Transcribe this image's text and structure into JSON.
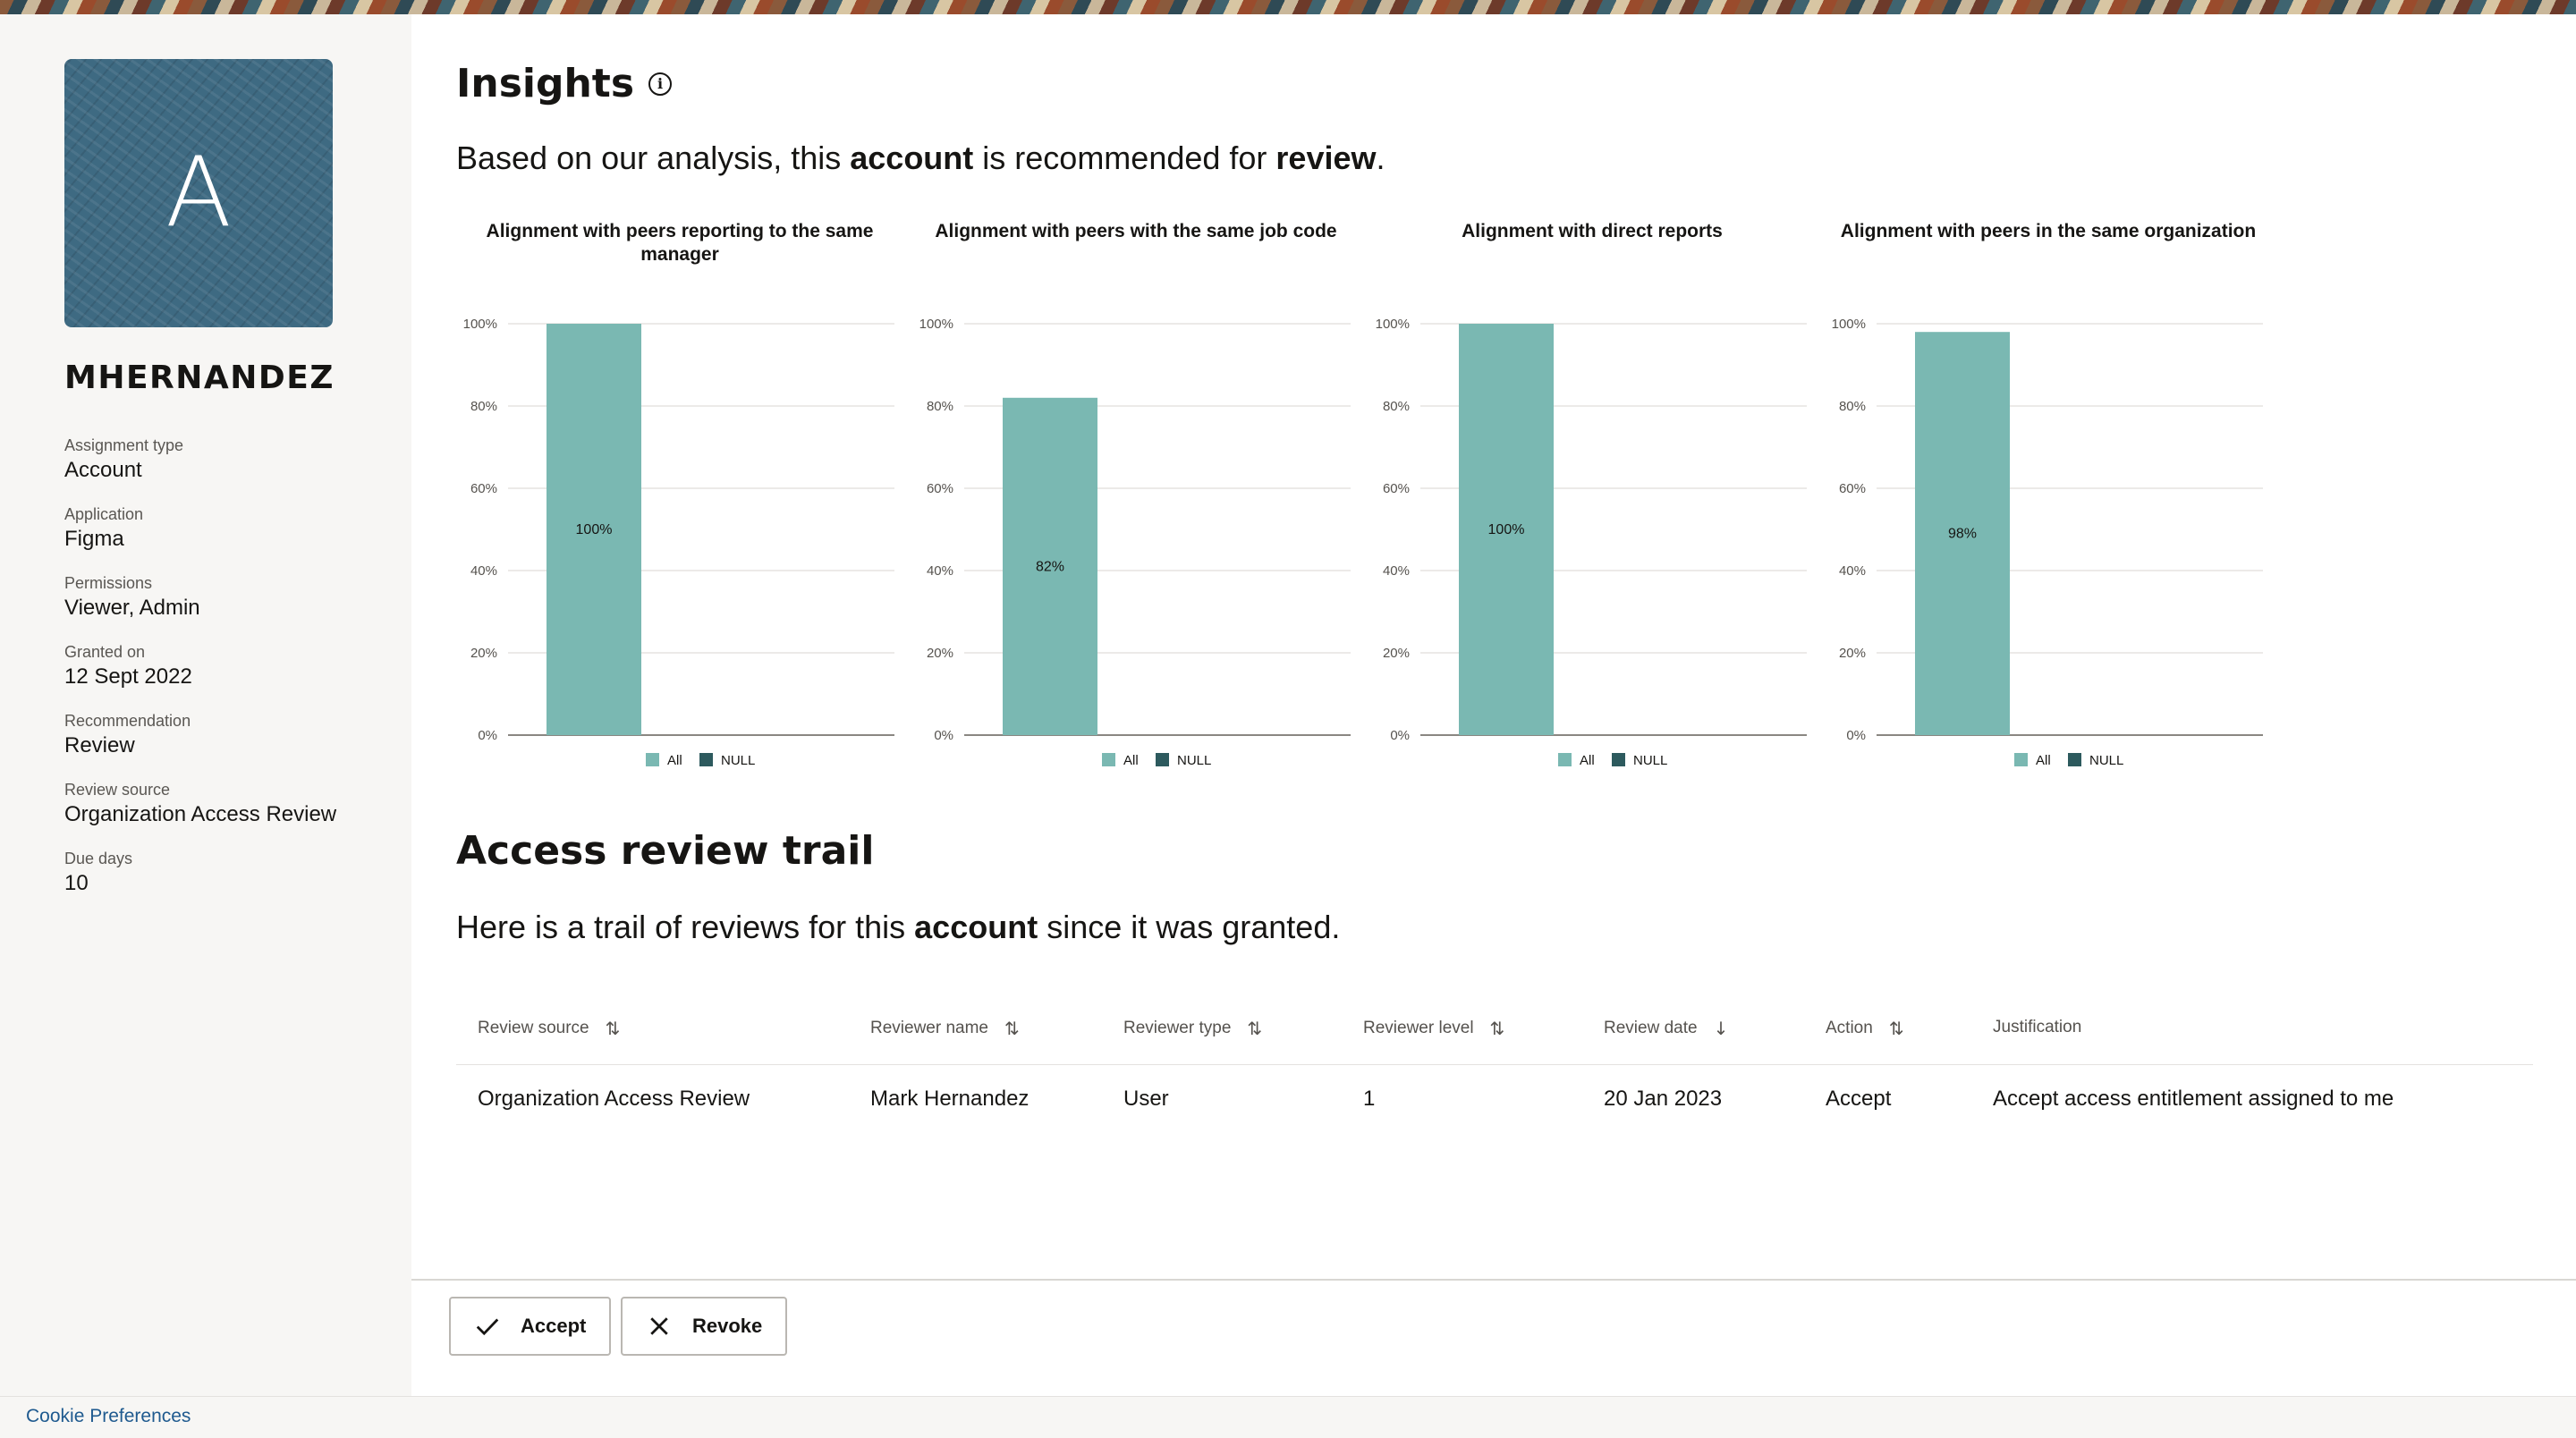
{
  "user": {
    "avatar_initial": "A",
    "username": "MHERNANDEZ",
    "fields": [
      {
        "label": "Assignment type",
        "value": "Account"
      },
      {
        "label": "Application",
        "value": "Figma"
      },
      {
        "label": "Permissions",
        "value": "Viewer, Admin"
      },
      {
        "label": "Granted on",
        "value": "12 Sept 2022"
      },
      {
        "label": "Recommendation",
        "value": "Review"
      },
      {
        "label": "Review source",
        "value": "Organization Access Review"
      },
      {
        "label": "Due days",
        "value": "10"
      }
    ]
  },
  "insights": {
    "title": "Insights",
    "lead_1": "Based on our analysis, this ",
    "lead_bold_1": "account",
    "lead_2": " is recommended for ",
    "lead_bold_2": "review",
    "lead_3": "."
  },
  "chart_data": [
    {
      "type": "bar",
      "title": "Alignment with peers reporting to the same manager",
      "categories": [
        "All",
        "NULL"
      ],
      "series": [
        {
          "name": "All",
          "values": [
            100
          ]
        },
        {
          "name": "NULL",
          "values": [
            0
          ]
        }
      ],
      "data_labels": [
        "100%"
      ],
      "y_ticks": [
        "0%",
        "20%",
        "40%",
        "60%",
        "80%",
        "100%"
      ],
      "ylim": [
        0,
        100
      ],
      "legend": "bottom",
      "grid": true
    },
    {
      "type": "bar",
      "title": "Alignment with peers with the same job code",
      "categories": [
        "All",
        "NULL"
      ],
      "series": [
        {
          "name": "All",
          "values": [
            82
          ]
        },
        {
          "name": "NULL",
          "values": [
            0
          ]
        }
      ],
      "data_labels": [
        "82%"
      ],
      "y_ticks": [
        "0%",
        "20%",
        "40%",
        "60%",
        "80%",
        "100%"
      ],
      "ylim": [
        0,
        100
      ],
      "legend": "bottom",
      "grid": true
    },
    {
      "type": "bar",
      "title": "Alignment with direct reports",
      "categories": [
        "All",
        "NULL"
      ],
      "series": [
        {
          "name": "All",
          "values": [
            100
          ]
        },
        {
          "name": "NULL",
          "values": [
            0
          ]
        }
      ],
      "data_labels": [
        "100%"
      ],
      "y_ticks": [
        "0%",
        "20%",
        "40%",
        "60%",
        "80%",
        "100%"
      ],
      "ylim": [
        0,
        100
      ],
      "legend": "bottom",
      "grid": true
    },
    {
      "type": "bar",
      "title": "Alignment with peers in the same organization",
      "categories": [
        "All",
        "NULL"
      ],
      "series": [
        {
          "name": "All",
          "values": [
            98
          ]
        },
        {
          "name": "NULL",
          "values": [
            0
          ]
        }
      ],
      "data_labels": [
        "98%"
      ],
      "y_ticks": [
        "0%",
        "20%",
        "40%",
        "60%",
        "80%",
        "100%"
      ],
      "ylim": [
        0,
        100
      ],
      "legend": "bottom",
      "grid": true
    }
  ],
  "colors": {
    "all": "#7ab8b2",
    "null": "#2d5a5e",
    "grid": "#e6e4e1",
    "axis": "#8a8782",
    "tick_text": "#55524e"
  },
  "trail": {
    "title": "Access review trail",
    "lead_1": "Here is a trail of reviews for this ",
    "lead_bold": "account",
    "lead_2": " since it was granted.",
    "columns": [
      {
        "label": "Review source",
        "sort_icon": "sort-both-icon",
        "glyph": "⇅"
      },
      {
        "label": "Reviewer name",
        "sort_icon": "sort-both-icon",
        "glyph": "⇅"
      },
      {
        "label": "Reviewer type",
        "sort_icon": "sort-both-icon",
        "glyph": "⇅"
      },
      {
        "label": "Reviewer level",
        "sort_icon": "sort-both-icon",
        "glyph": "⇅"
      },
      {
        "label": "Review date",
        "sort_icon": "sort-descending-icon",
        "glyph": "↓"
      },
      {
        "label": "Action",
        "sort_icon": "sort-both-icon",
        "glyph": "⇅"
      },
      {
        "label": "Justification",
        "sort_icon": "",
        "glyph": ""
      }
    ],
    "rows": [
      [
        "Organization Access Review",
        "Mark Hernandez",
        "User",
        "1",
        "20 Jan 2023",
        "Accept",
        "Accept access entitlement assigned to me"
      ]
    ]
  },
  "actions": {
    "accept_label": "Accept",
    "accept_icon": "check-icon",
    "revoke_label": "Revoke",
    "revoke_icon": "close-icon"
  },
  "footer": {
    "cookie_label": "Cookie Preferences"
  }
}
